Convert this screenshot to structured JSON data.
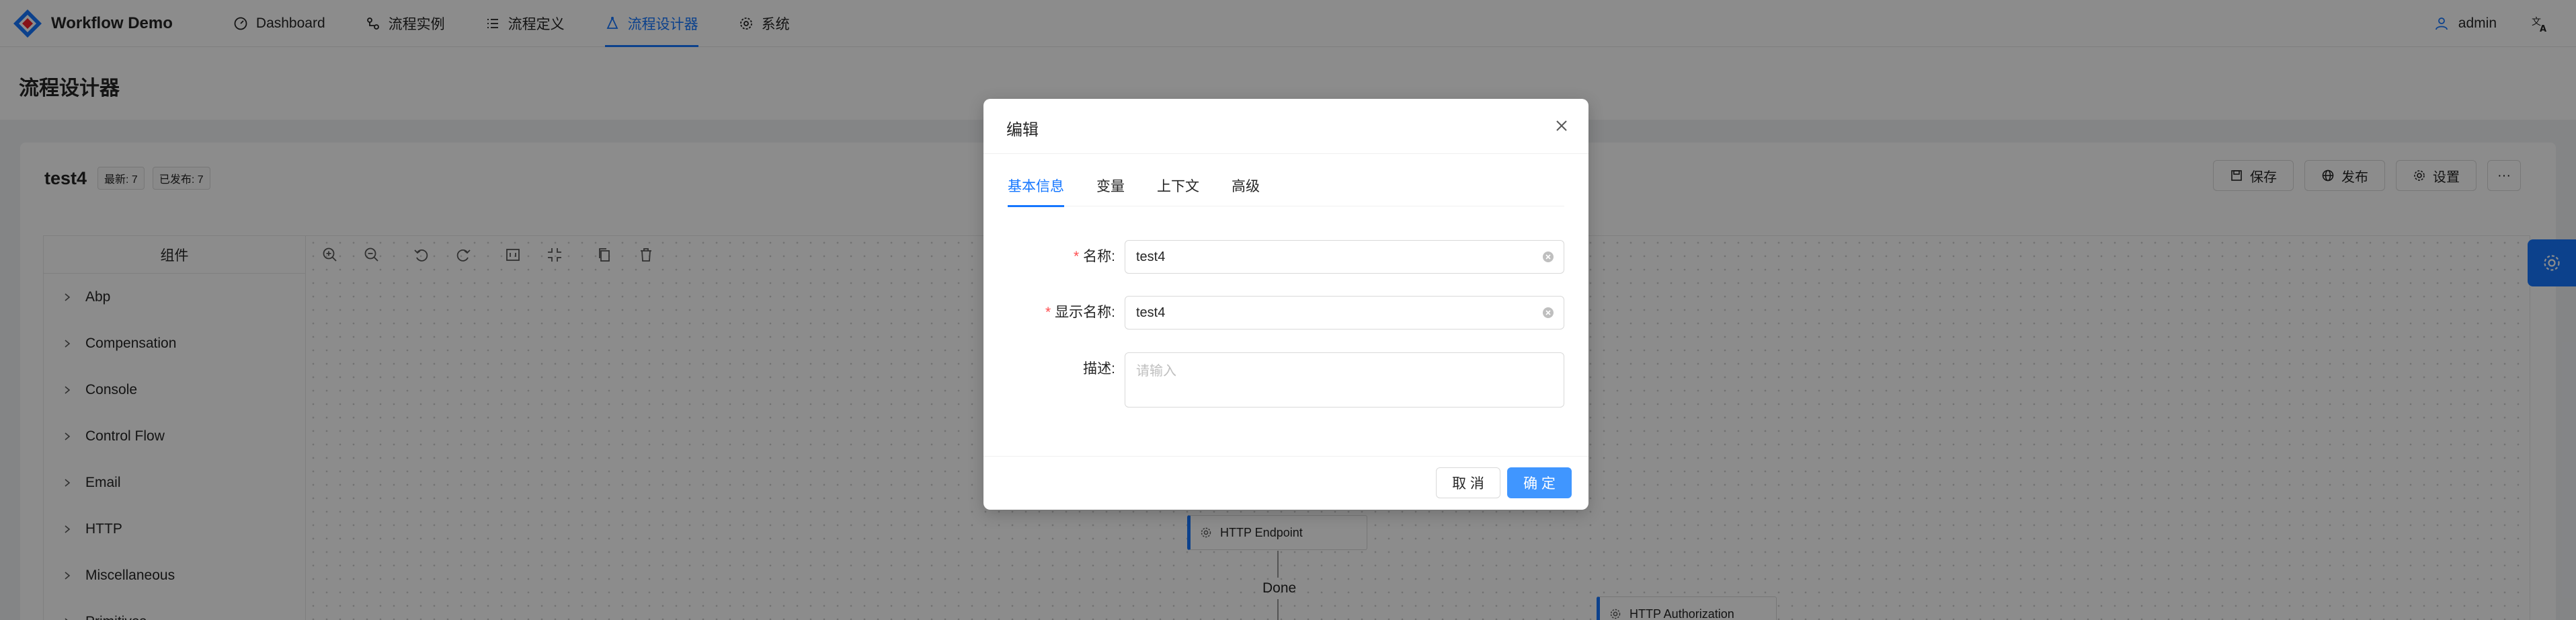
{
  "app": {
    "title": "Workflow Demo"
  },
  "nav": {
    "items": [
      {
        "label": "Dashboard",
        "icon": "dashboard-icon"
      },
      {
        "label": "流程实例",
        "icon": "instance-icon"
      },
      {
        "label": "流程定义",
        "icon": "list-icon"
      },
      {
        "label": "流程设计器",
        "icon": "designer-icon"
      },
      {
        "label": "系统",
        "icon": "gear-icon"
      }
    ],
    "active": "流程设计器",
    "user": "admin"
  },
  "page": {
    "title": "流程设计器"
  },
  "workflow": {
    "name": "test4",
    "tag_latest": "最新: 7",
    "tag_published": "已发布: 7",
    "actions": {
      "save": "保存",
      "publish": "发布",
      "settings": "设置",
      "more": "···"
    }
  },
  "components": {
    "header": "组件",
    "items": [
      "Abp",
      "Compensation",
      "Console",
      "Control Flow",
      "Email",
      "HTTP",
      "Miscellaneous",
      "Primitives"
    ]
  },
  "canvas": {
    "nodes": {
      "http_endpoint": "HTTP Endpoint",
      "http_authorization": "HTTP Authorization"
    },
    "outcome_label": "Done"
  },
  "modal": {
    "title": "编辑",
    "tabs": [
      "基本信息",
      "变量",
      "上下文",
      "高级"
    ],
    "active_tab": "基本信息",
    "fields": {
      "name": {
        "label": "名称:",
        "value": "test4",
        "required": true
      },
      "display_name": {
        "label": "显示名称:",
        "value": "test4",
        "required": true
      },
      "description": {
        "label": "描述:",
        "placeholder": "请输入"
      }
    },
    "cancel": "取 消",
    "ok": "确 定"
  },
  "colors": {
    "primary": "#1677ff",
    "required": "#ff4d4f"
  }
}
